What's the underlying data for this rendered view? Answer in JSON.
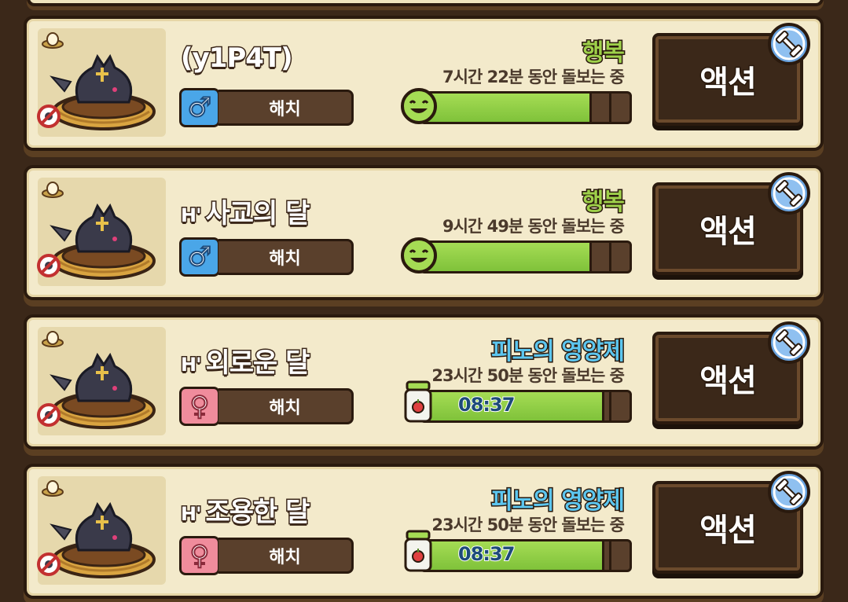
{
  "colors": {
    "background": "#3b2819",
    "card": "#f3eacb",
    "happy_text": "#9ed04a",
    "food_text": "#5cc6ef",
    "gauge_fill": "#a5dc54",
    "male": "#4aa6e8",
    "female": "#f08c9c"
  },
  "pets": [
    {
      "badge": "",
      "name": "(y1P4T)",
      "gender": "male",
      "gender_symbol": "♂",
      "stage": "해치",
      "state": "행복",
      "state_type": "happy",
      "care_text": "7시간 22분 동안 돌보는 중",
      "gauge_icon": "smile-face-icon",
      "gauge_fill": 0.82,
      "timer": "",
      "action_label": "액션"
    },
    {
      "badge": "H'",
      "name": "사교의 달",
      "gender": "male",
      "gender_symbol": "♂",
      "stage": "해치",
      "state": "행복",
      "state_type": "happy",
      "care_text": "9시간 49분 동안 돌보는 중",
      "gauge_icon": "smile-face-icon",
      "gauge_fill": 0.82,
      "timer": "",
      "action_label": "액션"
    },
    {
      "badge": "H'",
      "name": "외로운 달",
      "gender": "female",
      "gender_symbol": "♀",
      "stage": "해치",
      "state": "피노의 영양제",
      "state_type": "food",
      "care_text": "23시간 50분 동안 돌보는 중",
      "gauge_icon": "nutrient-jar-icon",
      "gauge_fill": 0.88,
      "timer": "08:37",
      "action_label": "액션"
    },
    {
      "badge": "H'",
      "name": "조용한 달",
      "gender": "female",
      "gender_symbol": "♀",
      "stage": "해치",
      "state": "피노의 영양제",
      "state_type": "food",
      "care_text": "23시간 50분 동안 돌보는 중",
      "gauge_icon": "nutrient-jar-icon",
      "gauge_fill": 0.88,
      "timer": "08:37",
      "action_label": "액션"
    }
  ]
}
